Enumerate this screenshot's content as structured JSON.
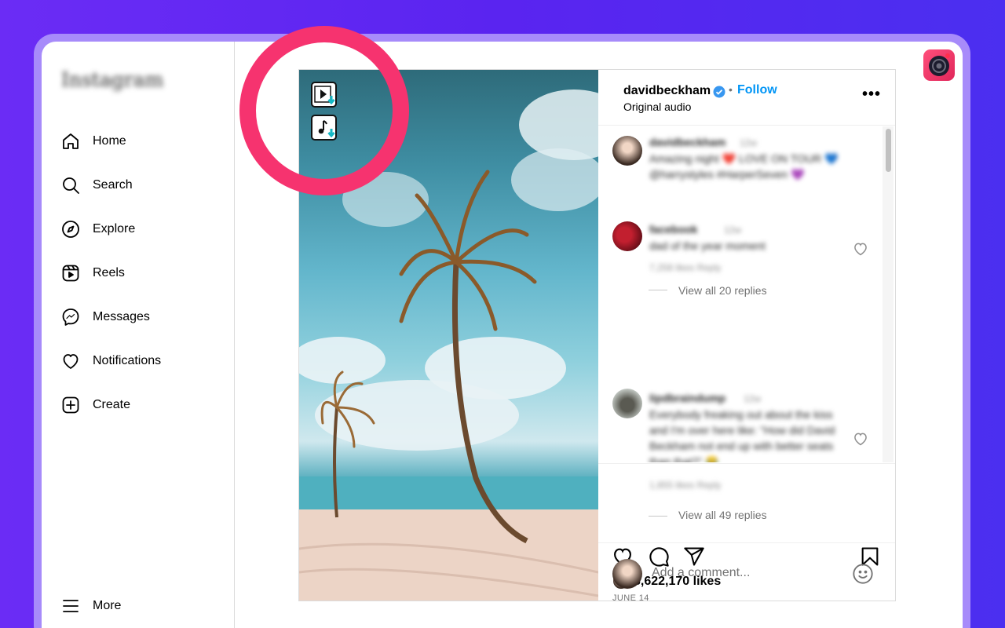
{
  "sidebar": {
    "logo": "Instagram",
    "items": [
      {
        "label": "Home",
        "icon": "home-icon"
      },
      {
        "label": "Search",
        "icon": "search-icon"
      },
      {
        "label": "Explore",
        "icon": "compass-icon"
      },
      {
        "label": "Reels",
        "icon": "reels-icon"
      },
      {
        "label": "Messages",
        "icon": "messenger-icon"
      },
      {
        "label": "Notifications",
        "icon": "heart-icon"
      },
      {
        "label": "Create",
        "icon": "plus-square-icon"
      }
    ],
    "more_label": "More"
  },
  "post": {
    "username": "davidbeckham",
    "follow_label": "Follow",
    "separator": "•",
    "audio": "Original audio",
    "likes": "3,622,170 likes",
    "date": "JUNE 14",
    "add_comment_placeholder": "Add a comment..."
  },
  "comments": [
    {
      "user": "davidbeckham",
      "time": "12w",
      "text": "Amazing night ❤️ LOVE ON TOUR 💙 @harrystyles #HarperSeven 💜",
      "meta": ""
    },
    {
      "user": "facebook",
      "time": "12w",
      "text": "dad of the year moment",
      "meta": "7,258 likes   Reply",
      "view_replies": "View all 20 replies"
    },
    {
      "user": "lipdbraindump",
      "time": "12w",
      "text": "Everybody freaking out about the kiss and I'm over here like: \"How did David Beckham not end up with better seats than that?\" 😂",
      "meta": "1,855 likes   Reply",
      "view_replies": "View all 49 replies"
    }
  ],
  "colors": {
    "highlight": "#f6336f",
    "follow": "#0095f6",
    "background": "#5a24f0",
    "extension": "#e0265a"
  }
}
